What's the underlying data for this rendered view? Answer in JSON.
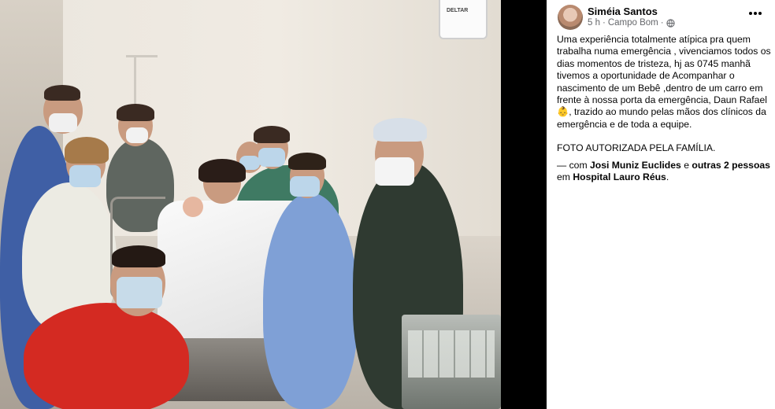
{
  "post": {
    "author": "Siméia Santos",
    "time": "5 h",
    "separator": "·",
    "location": "Campo Bom",
    "privacy_icon": "globe-icon",
    "more_icon": "more-options-icon",
    "body_line1": "Uma experiência totalmente atípica pra quem trabalha numa emergência , vivenciamos todos os dias momentos de tristeza, hj as 0745 manhã tivemos a oportunidade de Acompanhar o nascimento de um Bebê ,dentro de um carro em frente à nossa porta da emergência, Daun Rafael",
    "emoji": "👶",
    "body_line2": ", trazido ao mundo pelas mãos dos clínicos da emergência e de toda a equipe.",
    "body_para2": "FOTO AUTORIZADA PELA FAMÍLIA.",
    "tag_prefix": "— com",
    "tag_person": "Josi Muniz Euclides",
    "tag_and": "e",
    "tag_others": "outras 2 pessoas",
    "tag_in": "em",
    "tag_place": "Hospital Lauro Réus",
    "tag_end": "."
  },
  "photo": {
    "clock_brand": "DELTAR"
  },
  "colors": {
    "panel_bg": "#ffffff",
    "text": "#050505",
    "secondary": "#65676b",
    "scrub_blue": "#4f6fa8",
    "scrub_green": "#3c5a45",
    "jersey_red": "#d42a22"
  }
}
